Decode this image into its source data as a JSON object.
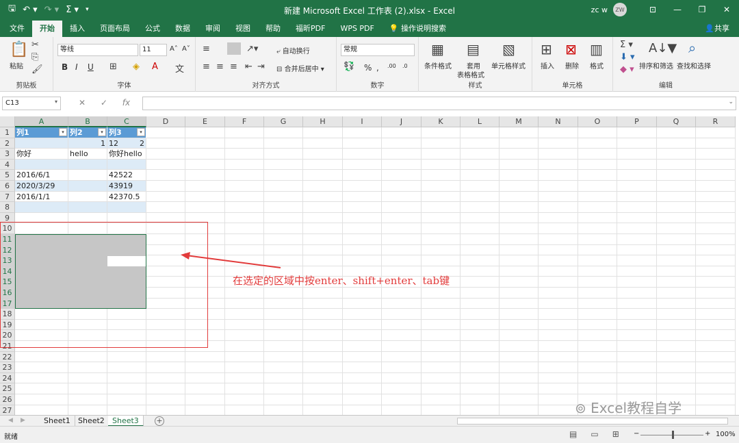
{
  "window": {
    "title": "新建 Microsoft Excel 工作表 (2).xlsx  -  Excel",
    "user": "zc w",
    "avatar_initials": "ZW"
  },
  "tabs": [
    "文件",
    "开始",
    "插入",
    "页面布局",
    "公式",
    "数据",
    "审阅",
    "视图",
    "帮助",
    "福昕PDF",
    "WPS PDF",
    "操作说明搜索"
  ],
  "active_tab": "开始",
  "share_label": "共享",
  "ribbon": {
    "clipboard": {
      "paste": "粘贴",
      "group": "剪贴板"
    },
    "font": {
      "name": "等线",
      "size": "11",
      "group": "字体",
      "bold": "B",
      "italic": "I",
      "underline": "U"
    },
    "alignment": {
      "wrap": "自动换行",
      "merge": "合并后居中",
      "group": "对齐方式"
    },
    "number": {
      "format": "常规",
      "group": "数字"
    },
    "styles": {
      "conditional": "条件格式",
      "table_line1": "套用",
      "table_line2": "表格格式",
      "cell_styles": "单元格样式",
      "group": "样式"
    },
    "cells": {
      "insert": "插入",
      "delete": "删除",
      "format": "格式",
      "group": "单元格"
    },
    "editing": {
      "sort": "排序和筛选",
      "find": "查找和选择",
      "group": "编辑"
    }
  },
  "formula_bar": {
    "name_box": "C13",
    "value": ""
  },
  "columns": [
    "A",
    "B",
    "C",
    "D",
    "E",
    "F",
    "G",
    "H",
    "I",
    "J",
    "K",
    "L",
    "M",
    "N",
    "O",
    "P",
    "Q",
    "R"
  ],
  "rows": [
    "1",
    "2",
    "3",
    "4",
    "5",
    "6",
    "7",
    "8",
    "9",
    "10",
    "11",
    "12",
    "13",
    "14",
    "15",
    "16",
    "17",
    "18",
    "19",
    "20",
    "21",
    "22",
    "23",
    "24",
    "25",
    "26",
    "27"
  ],
  "table": {
    "headers": [
      "列1",
      "列2",
      "列3"
    ],
    "cells": {
      "A2": "",
      "B2": "1",
      "C2": "2",
      "D2": "12",
      "A3": "你好",
      "B3": "hello",
      "C3": "你好hello",
      "A5": "2016/6/1",
      "C5": "42522",
      "A6": "2020/3/29",
      "C6": "43919",
      "A7": "2016/1/1",
      "C7": "42370.5"
    }
  },
  "annotation": "在选定的区域中按enter、shift+enter、tab键",
  "sheets": [
    "Sheet1",
    "Sheet2",
    "Sheet3"
  ],
  "active_sheet": "Sheet3",
  "status": {
    "ready": "就绪",
    "zoom": "100%"
  },
  "watermark": "Excel教程自学"
}
